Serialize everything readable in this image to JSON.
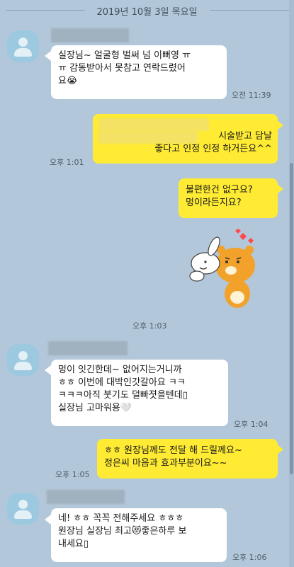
{
  "date_header": "2019년 10월 3일 목요일",
  "messages": [
    {
      "side": "in",
      "text": "실장님~ 얼굴형 벌써 넘 이뻐영 ㅠ\nㅠ 감동받아서 못참고 연락드렸어\n요😭",
      "time": "오전 11:39"
    },
    {
      "side": "out",
      "text": "시술받고 담날\n좋다고 인정 인정 하거든요^^",
      "time": "오후 1:01"
    },
    {
      "side": "out",
      "text": "불편한건 없구요?\n멍이라든지요?",
      "time": ""
    },
    {
      "side": "out",
      "sticker": "lion-sticker",
      "time": "오후 1:03"
    },
    {
      "side": "in",
      "text": "멍이 잇긴한데~ 없어지는거니까\nㅎㅎ 이번에 대박인갓갈아요 ㅋㅋ\nㅋㅋㅋ아직 붓기도 덜빠졋을텐데▯\n실장님 고마워용🤍",
      "time": "오후 1:04"
    },
    {
      "side": "out",
      "text": "ㅎㅎ 원장님께도 전달 해 드릴께요~\n정은씨 마음과 효과부분이요~~",
      "time": "오후 1:05"
    },
    {
      "side": "in",
      "text": "네! ㅎㅎ 꼭꼭 전해주세요 ㅎㅎㅎ\n원장님 실장님 최고😻좋은하루 보\n내세요▯",
      "time": "오후 1:06"
    }
  ],
  "icons": {
    "avatar": "person-silhouette-icon",
    "sticker": "lion-sticker"
  },
  "colors": {
    "background": "#b2c7d9",
    "my_bubble": "#ffeb33",
    "their_bubble": "#ffffff"
  }
}
